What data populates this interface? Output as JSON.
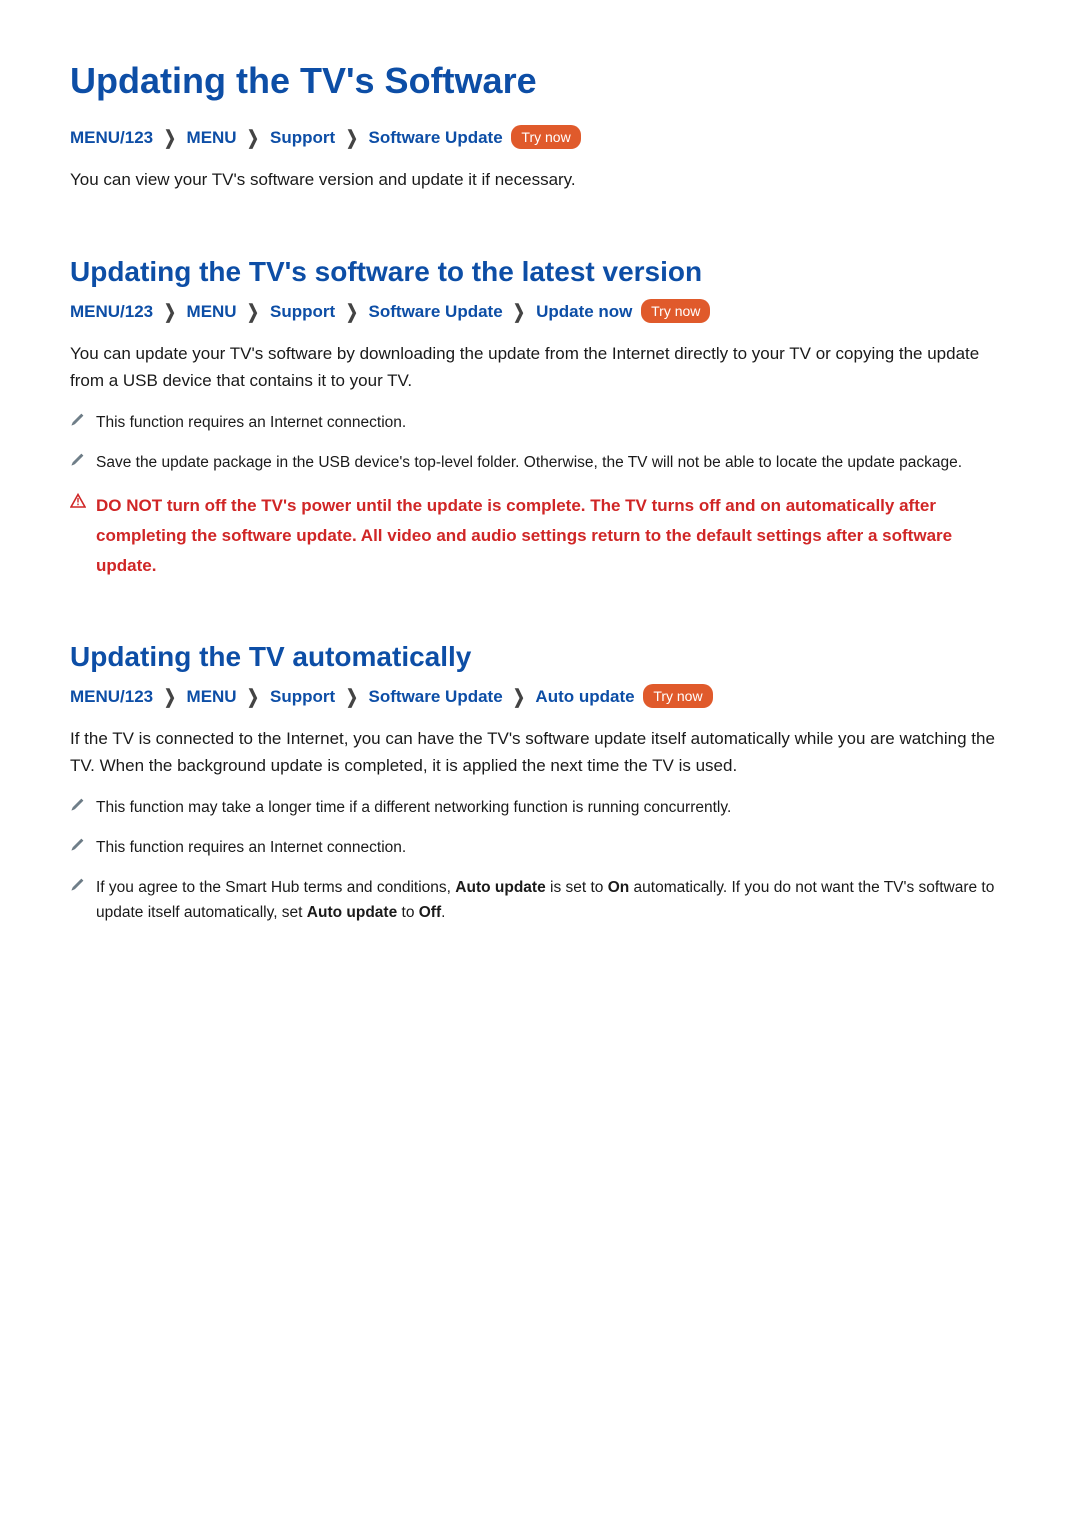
{
  "page_title": "Updating the TV's Software",
  "try_now_label": "Try now",
  "crumb_sep_icon": "chevron-right",
  "crumbs1": {
    "c1": "MENU/123",
    "c2": "MENU",
    "c3": "Support",
    "c4": "Software Update"
  },
  "intro1": "You can view your TV's software version and update it if necessary.",
  "section1_heading": "Updating the TV's software to the latest version",
  "crumbs2": {
    "c1": "MENU/123",
    "c2": "MENU",
    "c3": "Support",
    "c4": "Software Update",
    "c5": "Update now"
  },
  "section1_body": "You can update your TV's software by downloading the update from the Internet directly to your TV or copying the update from a USB device that contains it to your TV.",
  "note1": "This function requires an Internet connection.",
  "note2": "Save the update package in the USB device's top-level folder. Otherwise, the TV will not be able to locate the update package.",
  "warning1": "DO NOT turn off the TV's power until the update is complete. The TV turns off and on automatically after completing the software update. All video and audio settings return to the default settings after a software update.",
  "section2_heading": "Updating the TV automatically",
  "crumbs3": {
    "c1": "MENU/123",
    "c2": "MENU",
    "c3": "Support",
    "c4": "Software Update",
    "c5": "Auto update"
  },
  "section2_body": "If the TV is connected to the Internet, you can have the TV's software update itself automatically while you are watching the TV. When the background update is completed, it is applied the next time the TV is used.",
  "note3": "This function may take a longer time if a different networking function is running concurrently.",
  "note4": "This function requires an Internet connection.",
  "note5_pre": "If you agree to the Smart Hub terms and conditions, ",
  "note5_b1": "Auto update",
  "note5_mid1": " is set to ",
  "note5_b2": "On",
  "note5_mid2": " automatically. If you do not want the TV's software to update itself automatically, set ",
  "note5_b3": "Auto update",
  "note5_mid3": " to ",
  "note5_b4": "Off",
  "note5_end": "."
}
